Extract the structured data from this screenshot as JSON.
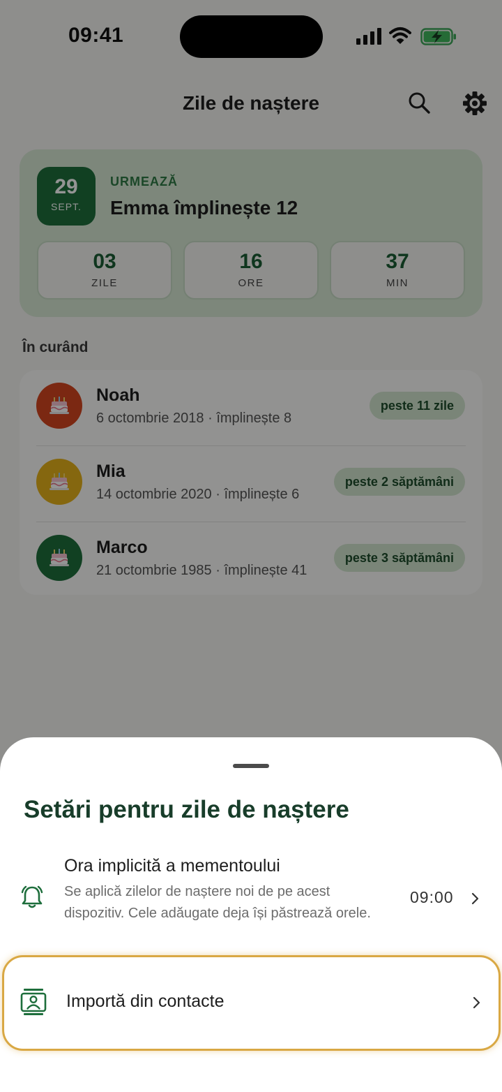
{
  "status_bar": {
    "time": "09:41"
  },
  "header": {
    "title": "Zile de naștere"
  },
  "next": {
    "day": "29",
    "month": "SEPT.",
    "label": "URMEAZĂ",
    "title": "Emma împlinește 12",
    "countdown": [
      {
        "value": "03",
        "unit": "ZILE"
      },
      {
        "value": "16",
        "unit": "ORE"
      },
      {
        "value": "37",
        "unit": "MIN"
      }
    ]
  },
  "upcoming": {
    "label": "În curând",
    "items": [
      {
        "name": "Noah",
        "detail": "6 octombrie 2018 · împlinește 8",
        "badge": "peste 11 zile",
        "color": "#d4461f"
      },
      {
        "name": "Mia",
        "detail": "14 octombrie 2020 · împlinește 6",
        "badge": "peste 2 săptămâni",
        "color": "#e6b21b"
      },
      {
        "name": "Marco",
        "detail": "21 octombrie 1985 · împlinește 41",
        "badge": "peste 3 săptămâni",
        "color": "#1e6e3c"
      }
    ]
  },
  "sheet": {
    "title": "Setări pentru zile de naștere",
    "reminder": {
      "title": "Ora implicită a mementoului",
      "description": "Se aplică zilelor de naștere noi de pe acest dispozitiv. Cele adăugate deja își păstrează orele.",
      "value": "09:00"
    },
    "import": {
      "label": "Importă din contacte"
    }
  },
  "colors": {
    "accent": "#1e6e3c",
    "highlight": "#d9a844"
  },
  "icons": [
    "search-icon",
    "gear-icon",
    "cake-icon",
    "bell-icon",
    "contact-card-icon",
    "chevron-right-icon"
  ]
}
